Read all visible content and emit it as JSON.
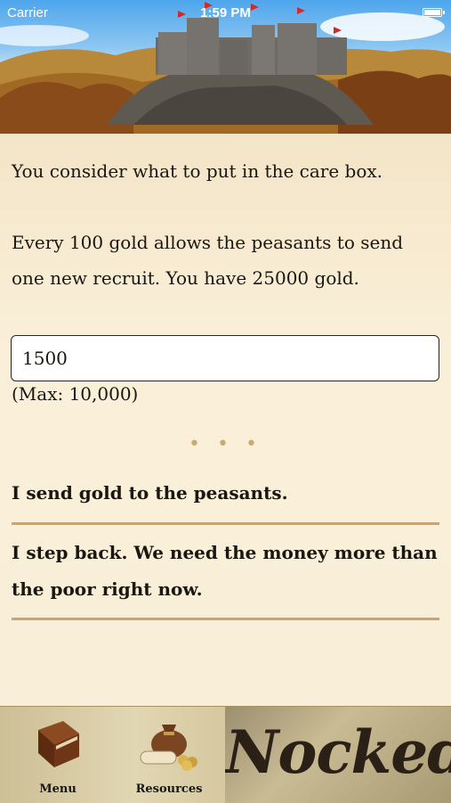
{
  "status_bar": {
    "carrier": "Carrier",
    "time": "1:59 PM"
  },
  "story": {
    "paragraph_1": "You consider what to put in the care box.",
    "paragraph_2": "Every 100 gold allows the peasants to send one new recruit. You have 25000 gold.",
    "gold_input_value": "1500",
    "max_hint": "(Max: 10,000)",
    "separator": "• • •"
  },
  "choices": [
    {
      "label": "I send gold to the peasants."
    },
    {
      "label": "I step back. We need the money more than the poor right now."
    }
  ],
  "bottom_bar": {
    "menu_label": "Menu",
    "resources_label": "Resources",
    "logo_text": "Nocked!"
  },
  "colors": {
    "parchment": "#f7ecd6",
    "rule": "#c8a579",
    "text": "#1a1610"
  }
}
